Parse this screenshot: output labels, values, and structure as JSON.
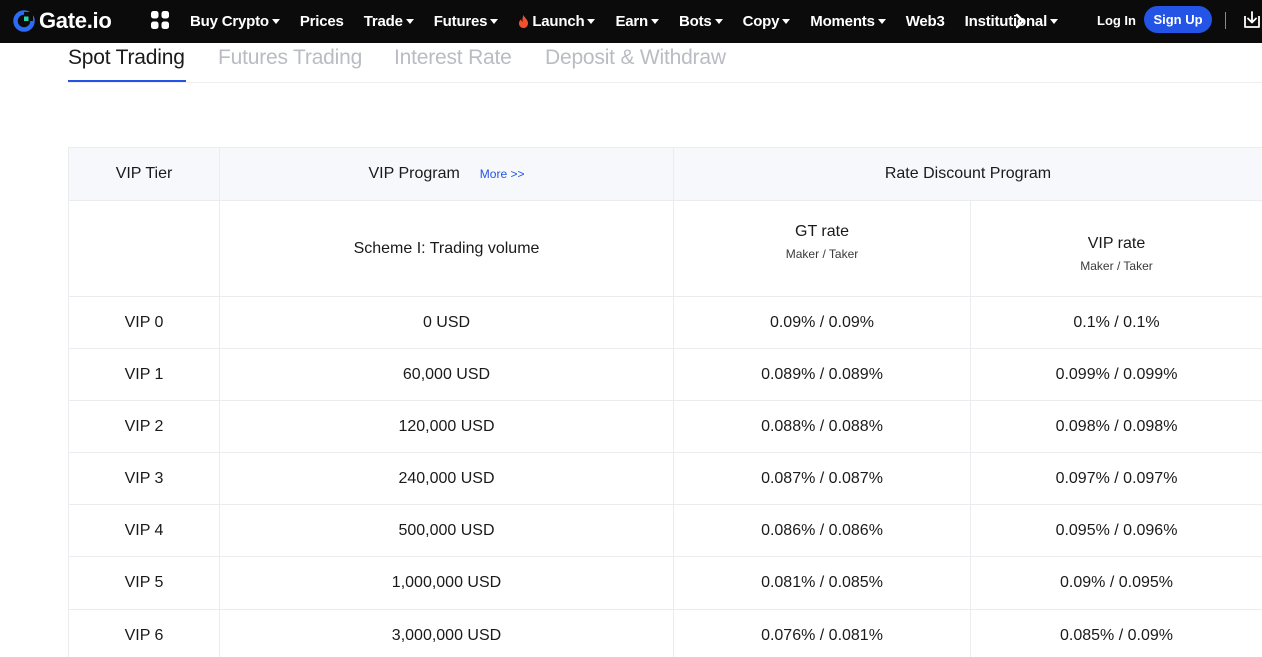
{
  "brand": {
    "name": "Gate.io",
    "accent": "#2354e6",
    "logo_color": "#2c6cf5"
  },
  "nav": {
    "items": [
      {
        "label": "Buy Crypto",
        "dropdown": true
      },
      {
        "label": "Prices",
        "dropdown": false
      },
      {
        "label": "Trade",
        "dropdown": true
      },
      {
        "label": "Futures",
        "dropdown": true
      },
      {
        "label": "Launch",
        "dropdown": true,
        "icon": "fire-icon"
      },
      {
        "label": "Earn",
        "dropdown": true
      },
      {
        "label": "Bots",
        "dropdown": true
      },
      {
        "label": "Copy",
        "dropdown": true
      },
      {
        "label": "Moments",
        "dropdown": true
      },
      {
        "label": "Web3",
        "dropdown": false
      },
      {
        "label": "Institutional",
        "dropdown": true
      }
    ],
    "login_label": "Log In",
    "signup_label": "Sign Up",
    "icons": [
      "apps-grid-icon",
      "chevron-right-icon",
      "download-icon"
    ]
  },
  "tabs": [
    {
      "label": "Spot Trading",
      "active": true
    },
    {
      "label": "Futures Trading",
      "active": false
    },
    {
      "label": "Interest Rate",
      "active": false
    },
    {
      "label": "Deposit & Withdraw",
      "active": false
    }
  ],
  "table": {
    "header": {
      "tier": "VIP Tier",
      "program": "VIP Program",
      "more_link": "More >>",
      "discount": "Rate Discount Program"
    },
    "subheader": {
      "scheme": "Scheme I: Trading volume",
      "gt_rate": "GT rate",
      "gt_rate_sub": "Maker / Taker",
      "vip_rate": "VIP rate",
      "vip_rate_sub": "Maker / Taker"
    },
    "rows": [
      {
        "tier": "VIP 0",
        "volume": "0 USD",
        "gt": "0.09% / 0.09%",
        "vip": "0.1% / 0.1%"
      },
      {
        "tier": "VIP 1",
        "volume": "60,000 USD",
        "gt": "0.089% / 0.089%",
        "vip": "0.099% / 0.099%"
      },
      {
        "tier": "VIP 2",
        "volume": "120,000 USD",
        "gt": "0.088% / 0.088%",
        "vip": "0.098% / 0.098%"
      },
      {
        "tier": "VIP 3",
        "volume": "240,000 USD",
        "gt": "0.087% / 0.087%",
        "vip": "0.097% / 0.097%"
      },
      {
        "tier": "VIP 4",
        "volume": "500,000 USD",
        "gt": "0.086% / 0.086%",
        "vip": "0.095% / 0.096%"
      },
      {
        "tier": "VIP 5",
        "volume": "1,000,000 USD",
        "gt": "0.081% / 0.085%",
        "vip": "0.09% / 0.095%"
      },
      {
        "tier": "VIP 6",
        "volume": "3,000,000 USD",
        "gt": "0.076% / 0.081%",
        "vip": "0.085% / 0.09%"
      }
    ]
  }
}
